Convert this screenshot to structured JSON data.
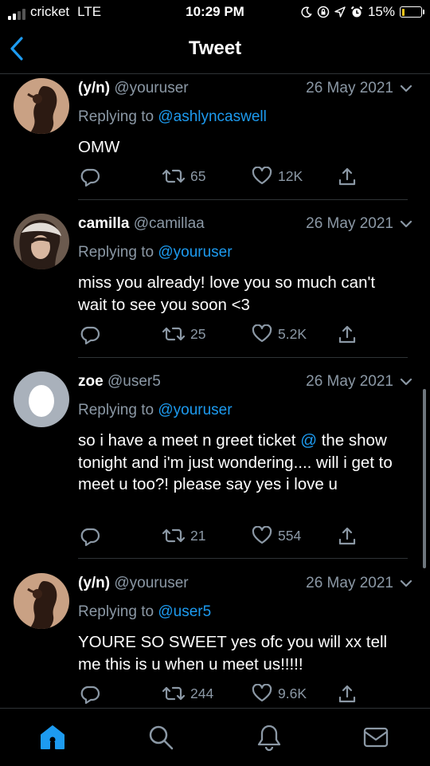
{
  "status_bar": {
    "carrier": "cricket",
    "network": "LTE",
    "time": "10:29 PM",
    "battery": "15%",
    "battery_level": 0.15,
    "battery_color": "#f0c419",
    "icons": [
      "signal-bars-icon",
      "moon-icon",
      "lock-rotation-icon",
      "location-arrow-icon",
      "alarm-icon",
      "battery-icon"
    ]
  },
  "nav": {
    "title": "Tweet",
    "back_icon": "chevron-left-icon"
  },
  "colors": {
    "accent": "#1d9bf0",
    "secondary_text": "#8b98a5",
    "background": "#000000"
  },
  "tweets": [
    {
      "name": "(y/n)",
      "handle": "@youruser",
      "date": "26 May 2021",
      "reply_prefix": "Replying to",
      "reply_to": "@ashlyncaswell",
      "text": "OMW",
      "retweets": "65",
      "likes": "12K"
    },
    {
      "name": "camilla",
      "handle": "@camillaa",
      "date": "26 May 2021",
      "reply_prefix": "Replying to",
      "reply_to": "@youruser",
      "text": "miss you already! love you so much can't wait to see you soon <3",
      "retweets": "25",
      "likes": "5.2K"
    },
    {
      "name": "zoe",
      "handle": "@user5",
      "date": "26 May 2021",
      "reply_prefix": "Replying to",
      "reply_to": "@youruser",
      "text_before": "so i have a meet n greet ticket",
      "text_at": "@",
      "text_after": "the show tonight and i'm just wondering.... will i get to meet u too?! please say yes i love u",
      "retweets": "21",
      "likes": "554"
    },
    {
      "name": "(y/n)",
      "handle": "@youruser",
      "date": "26 May 2021",
      "reply_prefix": "Replying to",
      "reply_to": "@user5",
      "text": "YOURE SO SWEET yes ofc you will xx tell me this is u when u meet us!!!!!",
      "retweets": "244",
      "likes": "9.6K"
    }
  ],
  "tab_bar": [
    "home-icon",
    "search-icon",
    "notifications-bell-icon",
    "messages-mail-icon"
  ]
}
